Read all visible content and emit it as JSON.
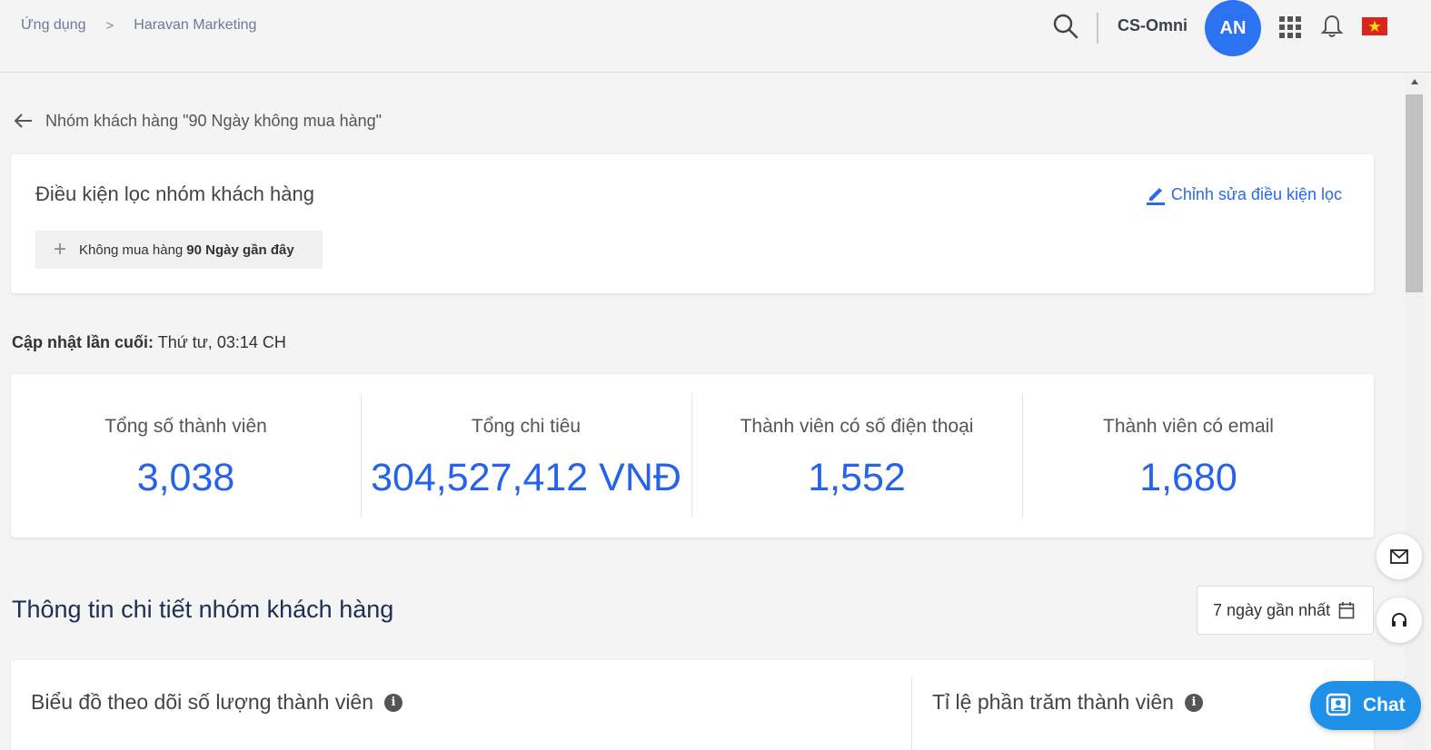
{
  "breadcrumb": {
    "item1": "Ứng dụng",
    "separator": ">",
    "item2": "Haravan Marketing"
  },
  "header": {
    "store_name": "CS-Omni",
    "avatar_initials": "AN"
  },
  "page": {
    "title": "Nhóm khách hàng \"90 Ngày không mua hàng\""
  },
  "filter": {
    "title": "Điều kiện lọc nhóm khách hàng",
    "edit_label": "Chỉnh sửa điều kiện lọc",
    "chip_prefix": "Không mua hàng",
    "chip_bold": "90 Ngày gần đây"
  },
  "last_updated": {
    "label": "Cập nhật lần cuối:",
    "value": "Thứ tư, 03:14 CH"
  },
  "stats": [
    {
      "label": "Tổng số thành viên",
      "value": "3,038"
    },
    {
      "label": "Tổng chi tiêu",
      "value": "304,527,412 VNĐ"
    },
    {
      "label": "Thành viên có số điện thoại",
      "value": "1,552"
    },
    {
      "label": "Thành viên có email",
      "value": "1,680"
    }
  ],
  "details": {
    "title": "Thông tin chi tiết nhóm khách hàng",
    "date_range": "7 ngày gần nhất",
    "chart1_title": "Biểu đồ theo dõi số lượng thành viên",
    "chart2_title": "Tỉ lệ phần trăm thành viên"
  },
  "chat": {
    "label": "Chat"
  },
  "colors": {
    "accent": "#2563eb",
    "avatar": "#2b73f0",
    "chat": "#1e90e8",
    "title": "#1e2f52"
  }
}
